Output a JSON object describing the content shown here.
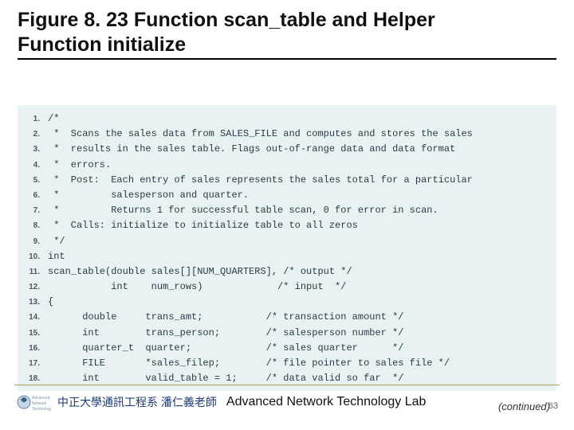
{
  "title": {
    "line1": "Figure 8. 23",
    "line2_rest": "  Function scan_table and Helper",
    "line3": "Function initialize"
  },
  "code": {
    "lines": [
      {
        "n": "1.",
        "t": "/*"
      },
      {
        "n": "2.",
        "t": " *  Scans the sales data from SALES_FILE and computes and stores the sales"
      },
      {
        "n": "3.",
        "t": " *  results in the sales table. Flags out-of-range data and data format"
      },
      {
        "n": "4.",
        "t": " *  errors."
      },
      {
        "n": "5.",
        "t": " *  Post:  Each entry of sales represents the sales total for a particular"
      },
      {
        "n": "6.",
        "t": " *         salesperson and quarter."
      },
      {
        "n": "7.",
        "t": " *         Returns 1 for successful table scan, 0 for error in scan."
      },
      {
        "n": "8.",
        "t": " *  Calls: initialize to initialize table to all zeros"
      },
      {
        "n": "9.",
        "t": " */"
      },
      {
        "n": "10.",
        "t": "int"
      },
      {
        "n": "11.",
        "t": "scan_table(double sales[][NUM_QUARTERS], /* output */"
      },
      {
        "n": "12.",
        "t": "           int    num_rows)             /* input  */"
      },
      {
        "n": "13.",
        "t": "{"
      },
      {
        "n": "14.",
        "t": "      double     trans_amt;           /* transaction amount */"
      },
      {
        "n": "15.",
        "t": "      int        trans_person;        /* salesperson number */"
      },
      {
        "n": "16.",
        "t": "      quarter_t  quarter;             /* sales quarter      */"
      },
      {
        "n": "17.",
        "t": "      FILE       *sales_filep;        /* file pointer to sales file */"
      },
      {
        "n": "18.",
        "t": "      int        valid_table = 1;     /* data valid so far  */"
      }
    ],
    "continued": "(continued)"
  },
  "footer": {
    "cn": "中正大學通訊工程系 潘仁義老師",
    "en": "Advanced Network Technology Lab",
    "page": "63"
  }
}
